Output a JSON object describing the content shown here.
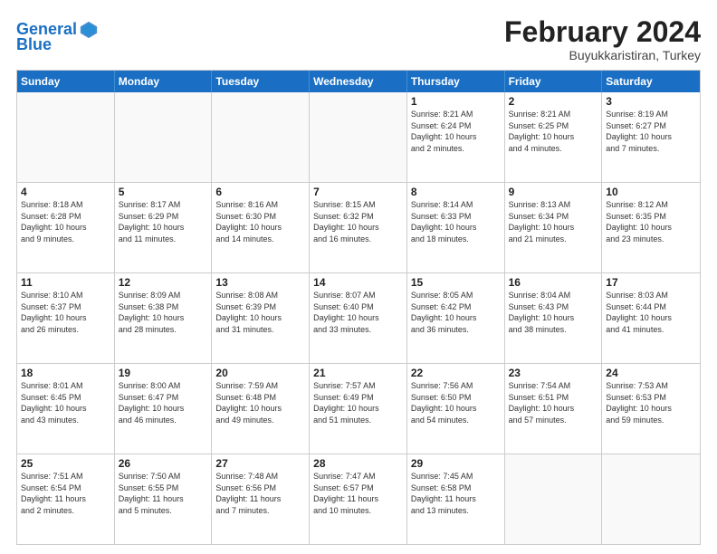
{
  "logo": {
    "line1": "General",
    "line2": "Blue"
  },
  "title": "February 2024",
  "subtitle": "Buyukkaristiran, Turkey",
  "days_header": [
    "Sunday",
    "Monday",
    "Tuesday",
    "Wednesday",
    "Thursday",
    "Friday",
    "Saturday"
  ],
  "weeks": [
    [
      {
        "day": "",
        "info": ""
      },
      {
        "day": "",
        "info": ""
      },
      {
        "day": "",
        "info": ""
      },
      {
        "day": "",
        "info": ""
      },
      {
        "day": "1",
        "info": "Sunrise: 8:21 AM\nSunset: 6:24 PM\nDaylight: 10 hours\nand 2 minutes."
      },
      {
        "day": "2",
        "info": "Sunrise: 8:21 AM\nSunset: 6:25 PM\nDaylight: 10 hours\nand 4 minutes."
      },
      {
        "day": "3",
        "info": "Sunrise: 8:19 AM\nSunset: 6:27 PM\nDaylight: 10 hours\nand 7 minutes."
      }
    ],
    [
      {
        "day": "4",
        "info": "Sunrise: 8:18 AM\nSunset: 6:28 PM\nDaylight: 10 hours\nand 9 minutes."
      },
      {
        "day": "5",
        "info": "Sunrise: 8:17 AM\nSunset: 6:29 PM\nDaylight: 10 hours\nand 11 minutes."
      },
      {
        "day": "6",
        "info": "Sunrise: 8:16 AM\nSunset: 6:30 PM\nDaylight: 10 hours\nand 14 minutes."
      },
      {
        "day": "7",
        "info": "Sunrise: 8:15 AM\nSunset: 6:32 PM\nDaylight: 10 hours\nand 16 minutes."
      },
      {
        "day": "8",
        "info": "Sunrise: 8:14 AM\nSunset: 6:33 PM\nDaylight: 10 hours\nand 18 minutes."
      },
      {
        "day": "9",
        "info": "Sunrise: 8:13 AM\nSunset: 6:34 PM\nDaylight: 10 hours\nand 21 minutes."
      },
      {
        "day": "10",
        "info": "Sunrise: 8:12 AM\nSunset: 6:35 PM\nDaylight: 10 hours\nand 23 minutes."
      }
    ],
    [
      {
        "day": "11",
        "info": "Sunrise: 8:10 AM\nSunset: 6:37 PM\nDaylight: 10 hours\nand 26 minutes."
      },
      {
        "day": "12",
        "info": "Sunrise: 8:09 AM\nSunset: 6:38 PM\nDaylight: 10 hours\nand 28 minutes."
      },
      {
        "day": "13",
        "info": "Sunrise: 8:08 AM\nSunset: 6:39 PM\nDaylight: 10 hours\nand 31 minutes."
      },
      {
        "day": "14",
        "info": "Sunrise: 8:07 AM\nSunset: 6:40 PM\nDaylight: 10 hours\nand 33 minutes."
      },
      {
        "day": "15",
        "info": "Sunrise: 8:05 AM\nSunset: 6:42 PM\nDaylight: 10 hours\nand 36 minutes."
      },
      {
        "day": "16",
        "info": "Sunrise: 8:04 AM\nSunset: 6:43 PM\nDaylight: 10 hours\nand 38 minutes."
      },
      {
        "day": "17",
        "info": "Sunrise: 8:03 AM\nSunset: 6:44 PM\nDaylight: 10 hours\nand 41 minutes."
      }
    ],
    [
      {
        "day": "18",
        "info": "Sunrise: 8:01 AM\nSunset: 6:45 PM\nDaylight: 10 hours\nand 43 minutes."
      },
      {
        "day": "19",
        "info": "Sunrise: 8:00 AM\nSunset: 6:47 PM\nDaylight: 10 hours\nand 46 minutes."
      },
      {
        "day": "20",
        "info": "Sunrise: 7:59 AM\nSunset: 6:48 PM\nDaylight: 10 hours\nand 49 minutes."
      },
      {
        "day": "21",
        "info": "Sunrise: 7:57 AM\nSunset: 6:49 PM\nDaylight: 10 hours\nand 51 minutes."
      },
      {
        "day": "22",
        "info": "Sunrise: 7:56 AM\nSunset: 6:50 PM\nDaylight: 10 hours\nand 54 minutes."
      },
      {
        "day": "23",
        "info": "Sunrise: 7:54 AM\nSunset: 6:51 PM\nDaylight: 10 hours\nand 57 minutes."
      },
      {
        "day": "24",
        "info": "Sunrise: 7:53 AM\nSunset: 6:53 PM\nDaylight: 10 hours\nand 59 minutes."
      }
    ],
    [
      {
        "day": "25",
        "info": "Sunrise: 7:51 AM\nSunset: 6:54 PM\nDaylight: 11 hours\nand 2 minutes."
      },
      {
        "day": "26",
        "info": "Sunrise: 7:50 AM\nSunset: 6:55 PM\nDaylight: 11 hours\nand 5 minutes."
      },
      {
        "day": "27",
        "info": "Sunrise: 7:48 AM\nSunset: 6:56 PM\nDaylight: 11 hours\nand 7 minutes."
      },
      {
        "day": "28",
        "info": "Sunrise: 7:47 AM\nSunset: 6:57 PM\nDaylight: 11 hours\nand 10 minutes."
      },
      {
        "day": "29",
        "info": "Sunrise: 7:45 AM\nSunset: 6:58 PM\nDaylight: 11 hours\nand 13 minutes."
      },
      {
        "day": "",
        "info": ""
      },
      {
        "day": "",
        "info": ""
      }
    ]
  ]
}
